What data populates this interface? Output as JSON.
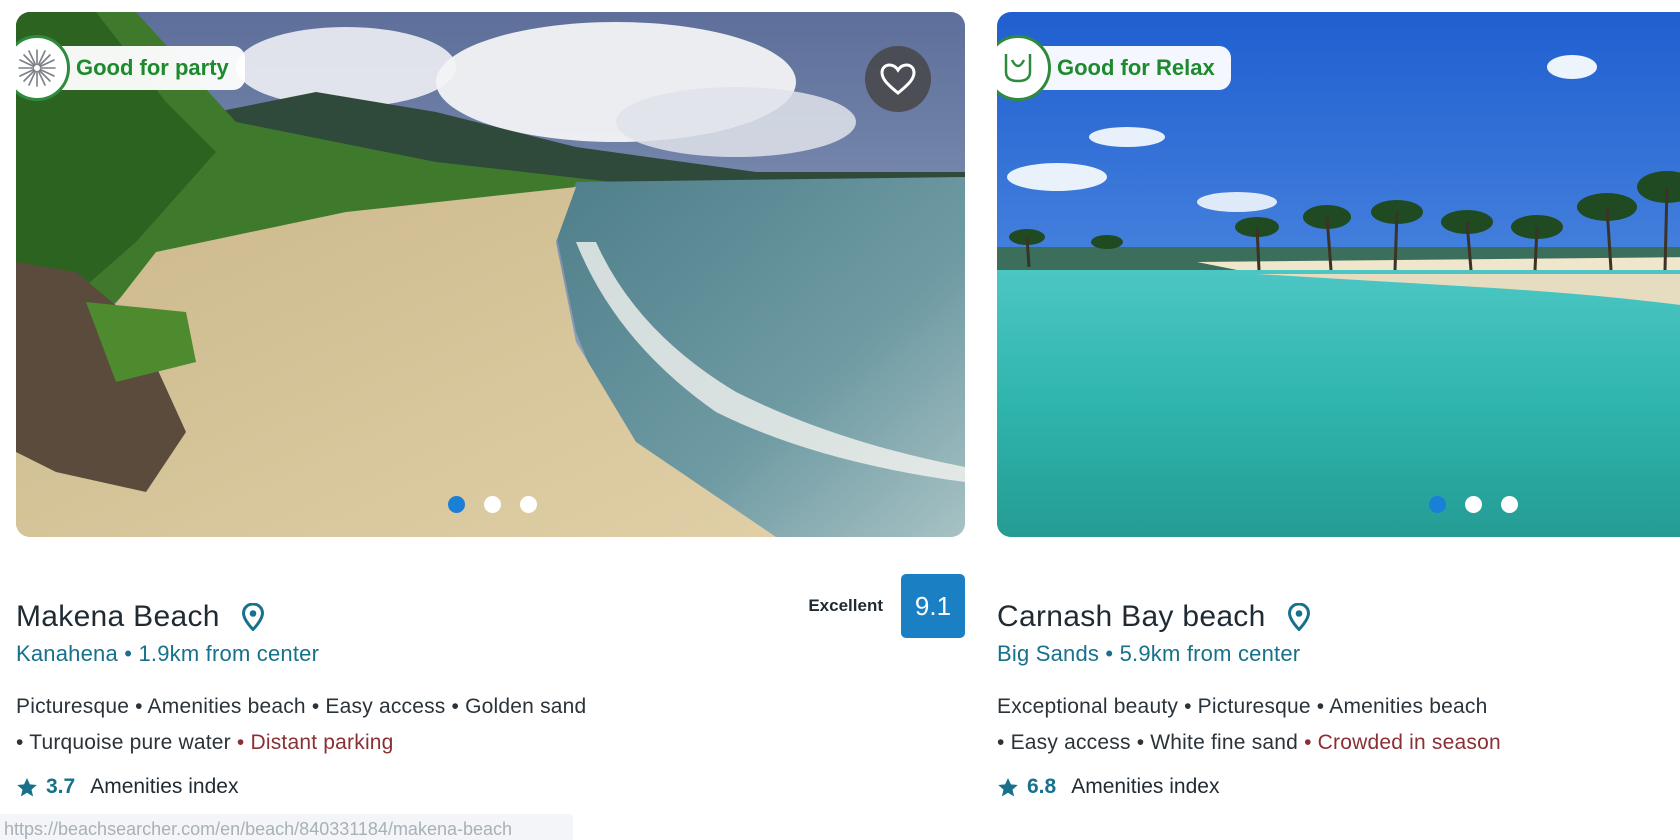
{
  "cards": [
    {
      "tag": {
        "label": "Good for party",
        "icon": "firework-icon"
      },
      "name": "Makena Beach",
      "location": "Kanahena • 1.9km from center",
      "rating": {
        "word": "Excellent",
        "score": "9.1"
      },
      "features": {
        "line1": "Picturesque • Amenities beach • Easy access • Golden sand",
        "line2": "• Turquoise pure water",
        "negative": " • Distant parking"
      },
      "amenities": {
        "score": "3.7",
        "label": "Amenities index"
      },
      "carousel": {
        "count": 3,
        "active": 1
      }
    },
    {
      "tag": {
        "label": "Good for Relax",
        "icon": "relax-icon"
      },
      "name": "Carnash Bay beach",
      "location": "Big Sands • 5.9km from center",
      "features": {
        "line1": "Exceptional beauty • Picturesque • Amenities beach",
        "line2": "• Easy access • White fine sand",
        "negative": " • Crowded in season"
      },
      "amenities": {
        "score": "6.8",
        "label": "Amenities index"
      },
      "carousel": {
        "count": 3,
        "active": 1
      }
    }
  ],
  "status_url": "https://beachsearcher.com/en/beach/840331184/makena-beach",
  "colors": {
    "accent_teal": "#17708c",
    "tag_green": "#1d8a2d",
    "score_blue": "#1b7fc4",
    "dot_active": "#1a7fd6",
    "negative_red": "#8a2f33"
  }
}
